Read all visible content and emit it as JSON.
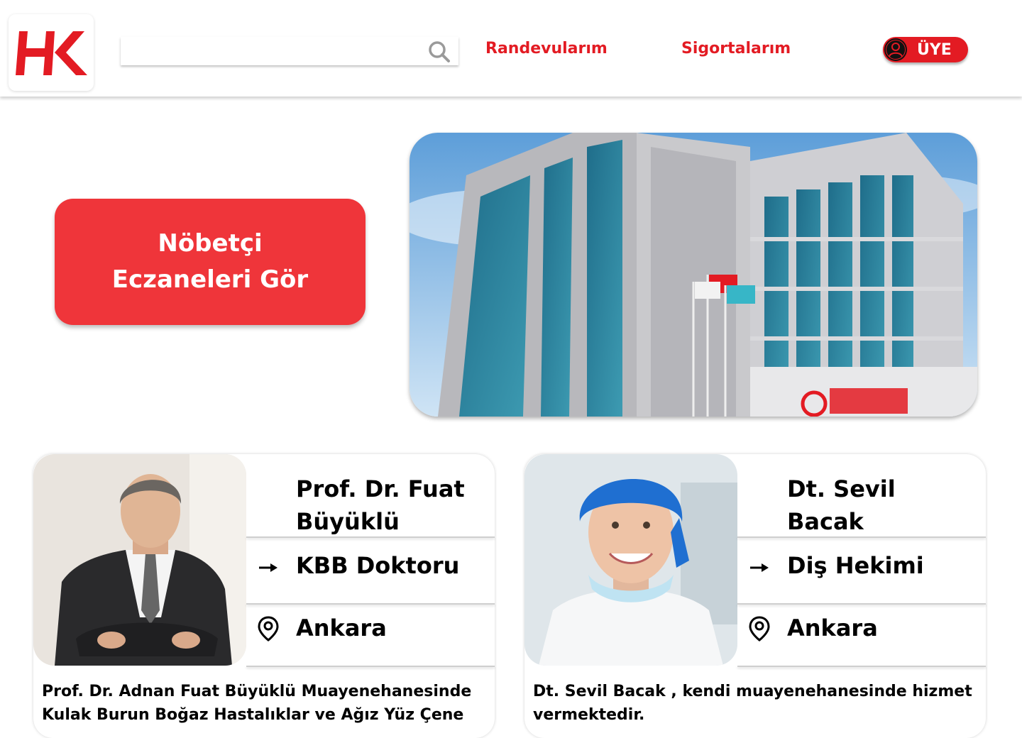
{
  "header": {
    "logo_text": "HK",
    "search": {
      "placeholder": "",
      "value": ""
    },
    "nav": {
      "appointments": "Randevularım",
      "insurance": "Sigortalarım"
    },
    "member_button": "ÜYE"
  },
  "hero": {
    "pharmacy_button": "Nöbetçi Eczaneleri Gör"
  },
  "doctors": [
    {
      "name": "Prof. Dr. Fuat Büyüklü",
      "specialty": "KBB Doktoru",
      "city": "Ankara",
      "description": "Prof. Dr. Adnan Fuat Büyüklü Muayenehanesinde Kulak Burun Boğaz Hastalıklar ve Ağız Yüz Çene"
    },
    {
      "name": "Dt. Sevil Bacak",
      "specialty": "Diş Hekimi",
      "city": "Ankara",
      "description": "Dt. Sevil Bacak , kendi muayenehanesinde hizmet vermektedir."
    }
  ],
  "colors": {
    "brand_red": "#e31b23",
    "button_red": "#ef353a"
  }
}
